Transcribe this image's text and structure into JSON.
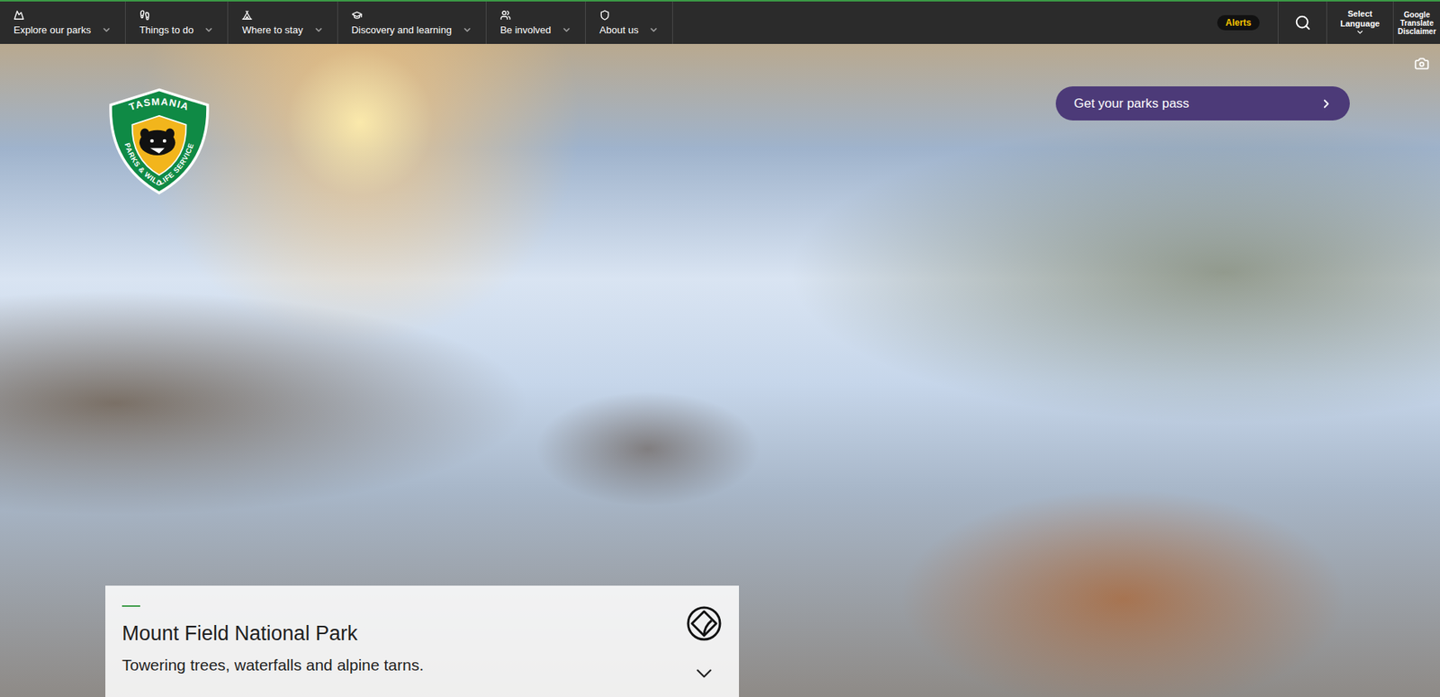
{
  "logo": {
    "top": "TASMANIA",
    "bottom": "PARKS & WILDLIFE SERVICE"
  },
  "nav": {
    "items": [
      {
        "label": "Explore our parks"
      },
      {
        "label": "Things to do"
      },
      {
        "label": "Where to stay"
      },
      {
        "label": "Discovery and learning"
      },
      {
        "label": "Be involved"
      },
      {
        "label": "About us"
      }
    ],
    "alerts": "Alerts",
    "language": "Select Language",
    "disclaimer": "Google Translate Disclaimer"
  },
  "hero": {
    "cta": "Get your parks pass",
    "card": {
      "title": "Mount Field National Park",
      "subtitle": "Towering trees, waterfalls and alpine tarns."
    }
  }
}
